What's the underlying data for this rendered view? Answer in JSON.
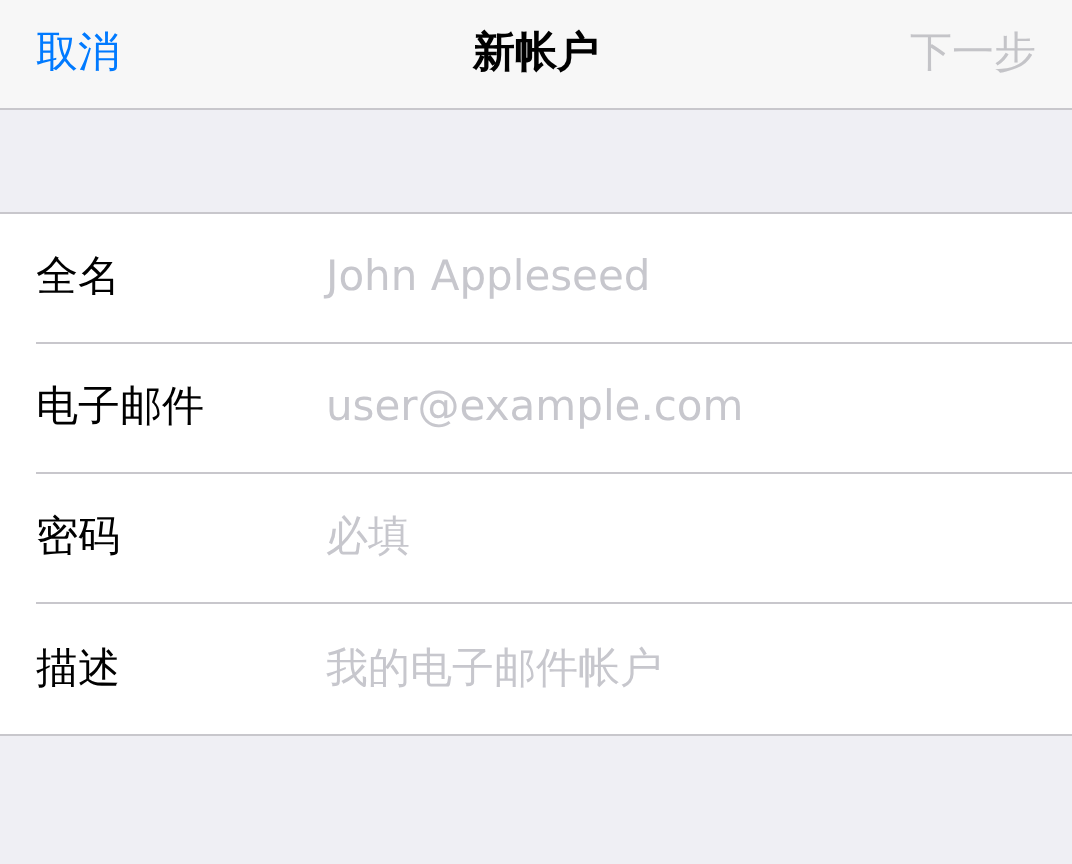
{
  "nav": {
    "cancel": "取消",
    "title": "新帐户",
    "next": {
      "label": "下一步",
      "disabled": true
    }
  },
  "fields": [
    {
      "label": "全名",
      "placeholder": "John Appleseed"
    },
    {
      "label": "电子邮件",
      "placeholder": "user@example.com"
    },
    {
      "label": "密码",
      "placeholder": "必填"
    },
    {
      "label": "描述",
      "placeholder": "我的电子邮件帐户"
    }
  ]
}
